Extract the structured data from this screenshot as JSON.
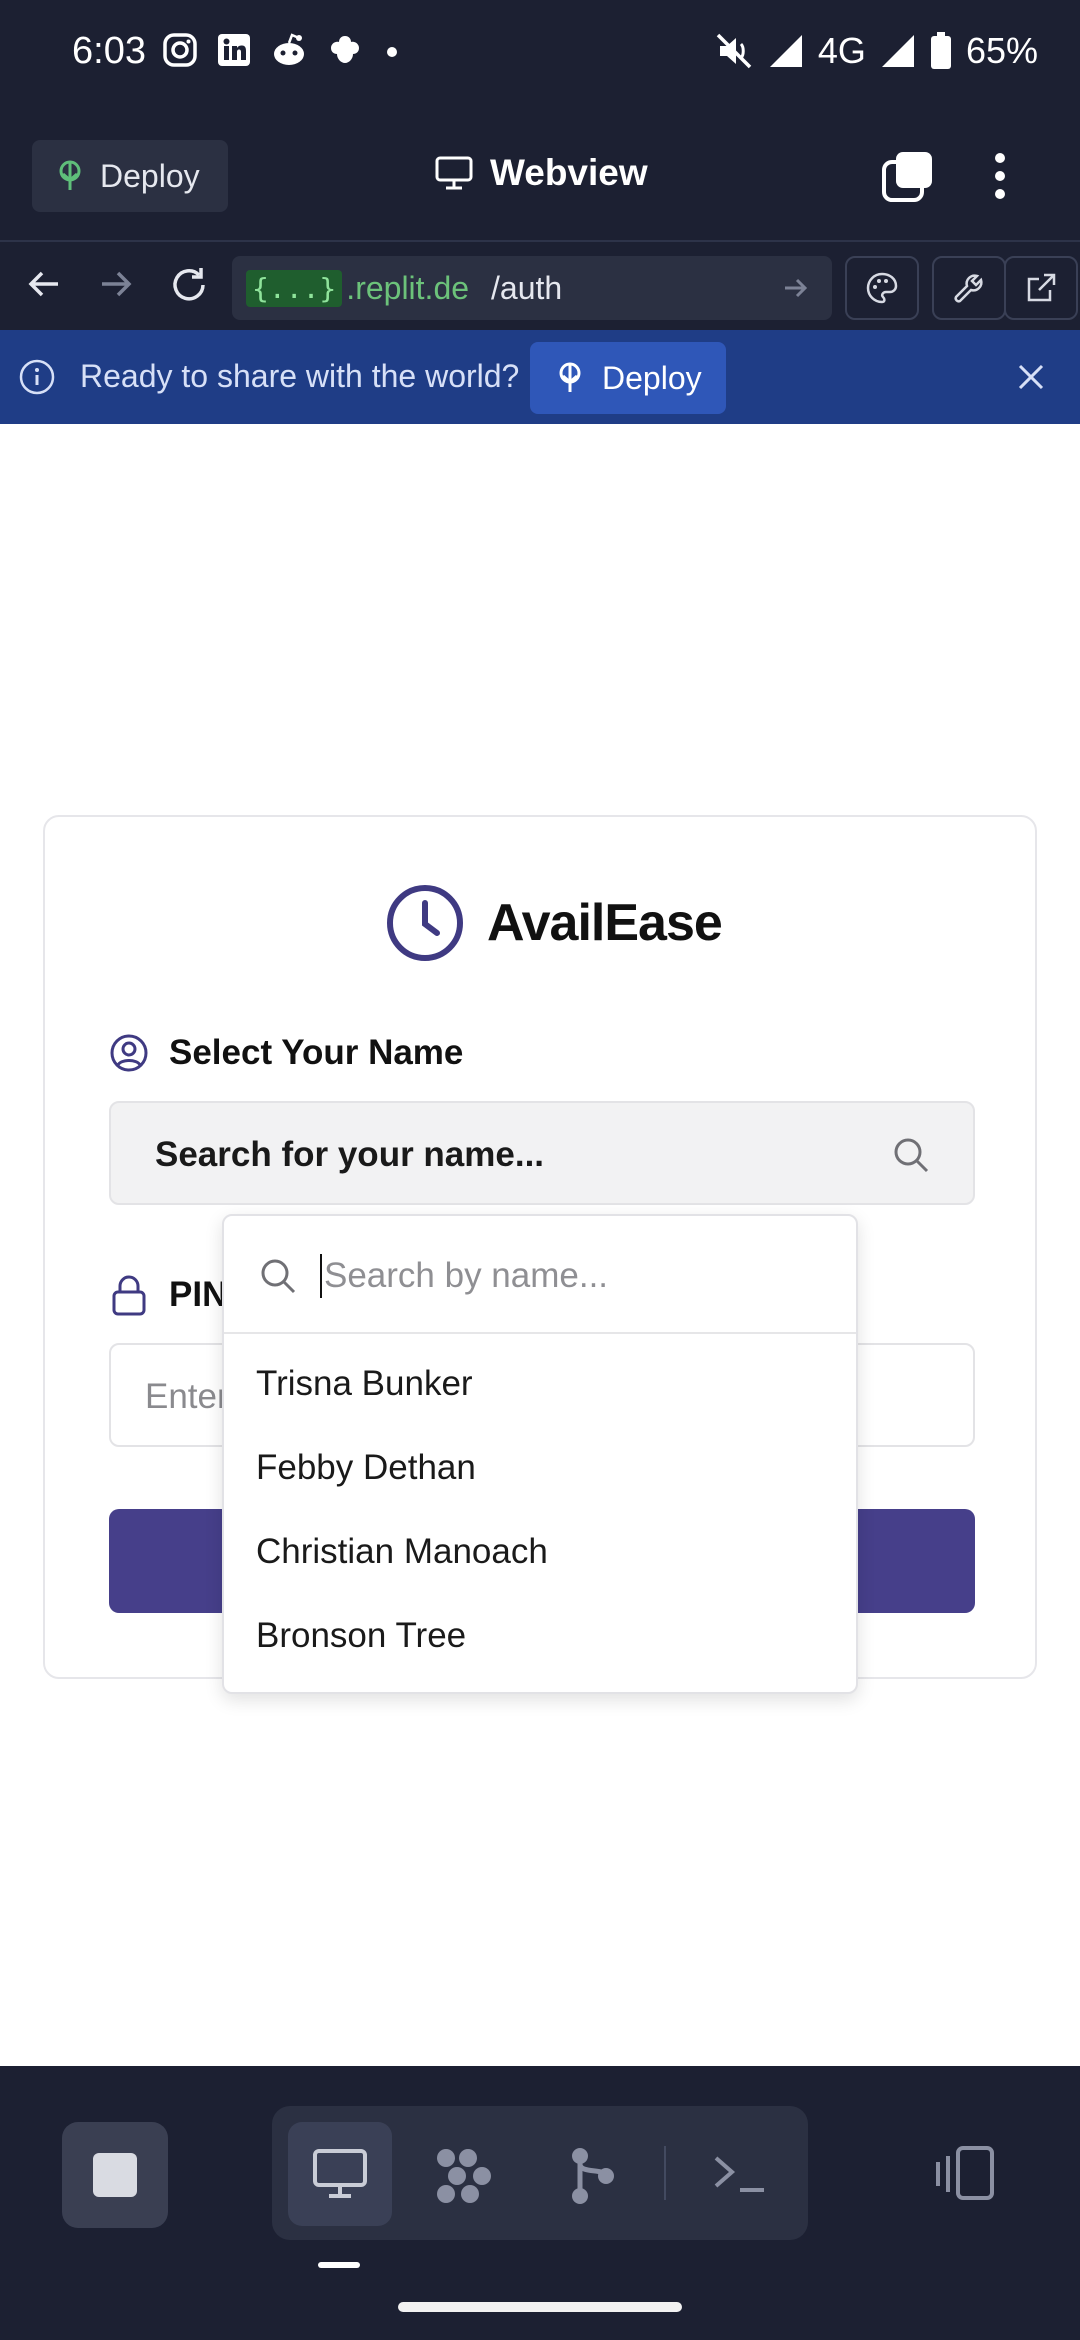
{
  "status_bar": {
    "time": "6:03",
    "network": "4G",
    "battery": "65%"
  },
  "header": {
    "deploy_label": "Deploy",
    "title": "Webview"
  },
  "url_bar": {
    "chip": "{...}",
    "domain": ".replit.de",
    "path": "/auth"
  },
  "banner": {
    "text": "Ready to share with the world?",
    "button": "Deploy"
  },
  "app": {
    "brand": "AvailEase",
    "name_label": "Select Your Name",
    "name_search_trigger": "Search for your name...",
    "pin_label": "PIN",
    "pin_placeholder": "Enter"
  },
  "dropdown": {
    "search_placeholder": "Search by name...",
    "options": [
      "Trisna Bunker",
      "Febby Dethan",
      "Christian Manoach",
      "Bronson Tree"
    ]
  },
  "colors": {
    "accent": "#463f8a",
    "banner": "#1f3d86",
    "chrome": "#1c2032"
  }
}
